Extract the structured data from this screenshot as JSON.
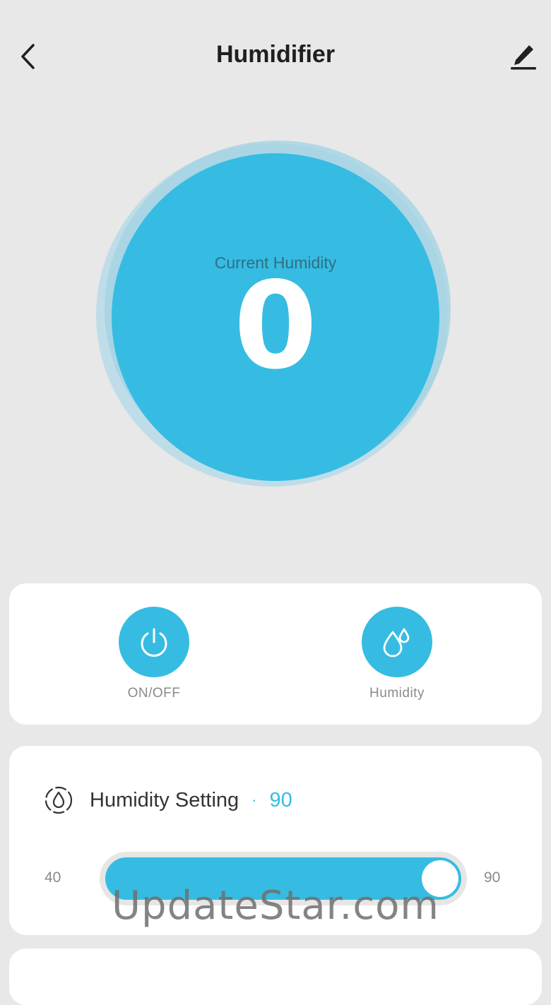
{
  "header": {
    "title": "Humidifier",
    "back_icon": "chevron-left-icon",
    "edit_icon": "pencil-icon"
  },
  "status": {
    "label": "Current Humidity",
    "value": "0"
  },
  "controls": [
    {
      "label": "ON/OFF",
      "icon": "power-icon"
    },
    {
      "label": "Humidity",
      "icon": "water-drops-icon"
    }
  ],
  "setting": {
    "label": "Humidity Setting",
    "separator": "·",
    "value": "90",
    "min": "40",
    "max": "90",
    "level_fraction": 1.0
  },
  "watermark": "UpdateStar.com",
  "colors": {
    "accent": "#36bce2",
    "background": "#e8e8e8",
    "card": "#ffffff",
    "muted_text": "#8a8a8a"
  }
}
